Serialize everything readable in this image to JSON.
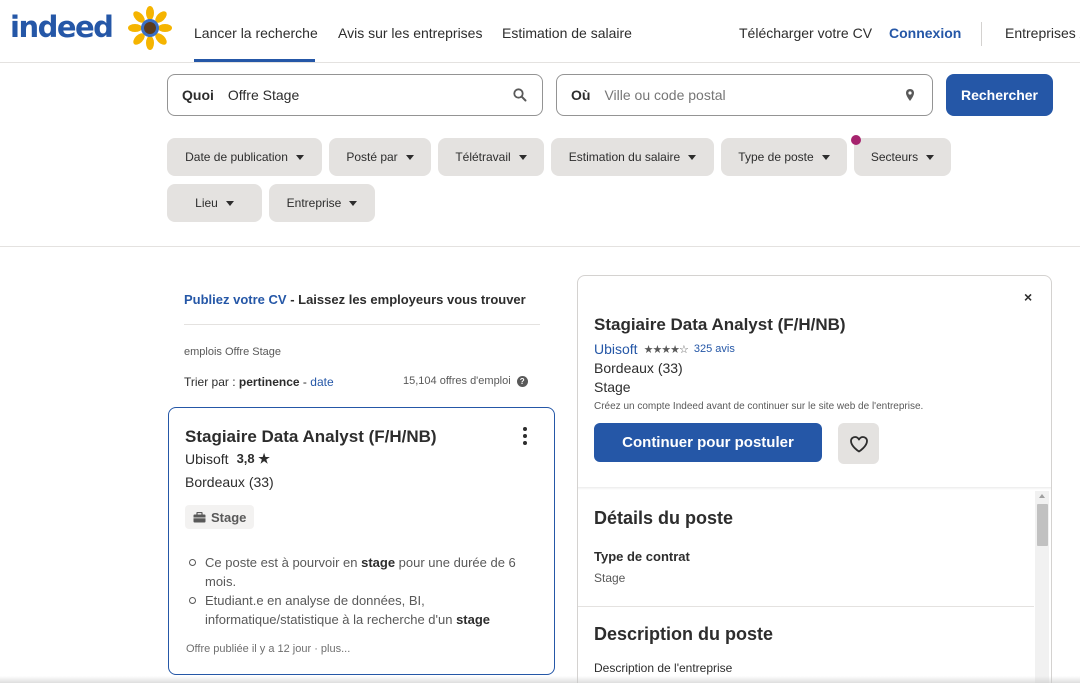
{
  "brand": {
    "logo_text": "indeed",
    "accent": "#2557a7",
    "filter_dot_color": "#a6236e"
  },
  "nav": {
    "find_jobs": "Lancer la recherche",
    "company_reviews": "Avis sur les entreprises",
    "salary": "Estimation de salaire",
    "upload_cv": "Télécharger votre CV",
    "sign_in": "Connexion",
    "employers": "Entreprises /"
  },
  "search": {
    "what_label": "Quoi",
    "what_value": "Offre Stage",
    "where_label": "Où",
    "where_placeholder": "Ville ou code postal",
    "button": "Rechercher"
  },
  "filters": [
    "Date de publication",
    "Posté par",
    "Télétravail",
    "Estimation du salaire",
    "Type de poste",
    "Secteurs",
    "Lieu",
    "Entreprise"
  ],
  "results": {
    "promo_link": "Publiez votre CV",
    "promo_text": " - Laissez les employeurs vous trouver",
    "breadcrumb": "emplois Offre Stage",
    "sort_prefix": "Trier par : ",
    "sort_active": "pertinence",
    "sort_sep": " - ",
    "sort_other": "date",
    "count": "15,104 offres d'emploi"
  },
  "job_card": {
    "title": "Stagiaire Data Analyst (F/H/NB)",
    "company": "Ubisoft",
    "rating": "3,8 ★",
    "location": "Bordeaux (33)",
    "tag": "Stage",
    "bullet1_a": "Ce poste est à pourvoir en ",
    "bullet1_b": "stage",
    "bullet1_c": " pour une durée de 6 mois.",
    "bullet2_a": "Etudiant.e en analyse de données, BI, informatique/statistique à la recherche d'un ",
    "bullet2_b": "stage",
    "posted": "Offre publiée il y a 12 jour   ·   plus..."
  },
  "detail": {
    "close": "×",
    "title": "Stagiaire Data Analyst (F/H/NB)",
    "company": "Ubisoft",
    "stars": "★★★★☆",
    "reviews": "325 avis",
    "location": "Bordeaux (33)",
    "type": "Stage",
    "note": "Créez un compte Indeed avant de continuer sur le site web de l'entreprise.",
    "apply_button": "Continuer pour postuler",
    "details_heading": "Détails du poste",
    "contract_label": "Type de contrat",
    "contract_value": "Stage",
    "description_heading": "Description du poste",
    "description_sub": "Description de l'entreprise"
  }
}
